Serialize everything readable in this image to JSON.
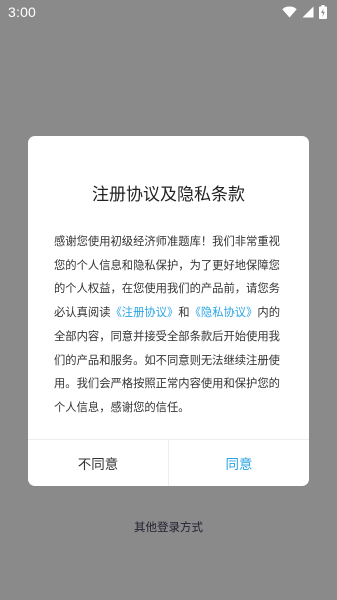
{
  "status_bar": {
    "time": "3:00",
    "icons": [
      "wifi-icon",
      "signal-icon",
      "battery-charging-icon"
    ]
  },
  "dialog": {
    "title": "注册协议及隐私条款",
    "body_1": "感谢您使用初级经济师准题库！我们非常重视您的个人信息和隐私保护，为了更好地保障您的个人权益，在您使用我们的产品前，请您务必认真阅读",
    "link_register": "《注册协议》",
    "and": "和",
    "link_privacy": "《隐私协议》",
    "body_2": "内的全部内容，同意并接受全部条款后开始使用我们的产品和服务。如不同意则无法继续注册使用。我们会严格按照正常内容使用和保护您的个人信息，感谢您的信任。",
    "disagree": "不同意",
    "agree": "同意"
  },
  "other_login": "其他登录方式",
  "colors": {
    "overlay": "#8a8a8a",
    "link": "#2aa4e4",
    "text": "#333333"
  }
}
